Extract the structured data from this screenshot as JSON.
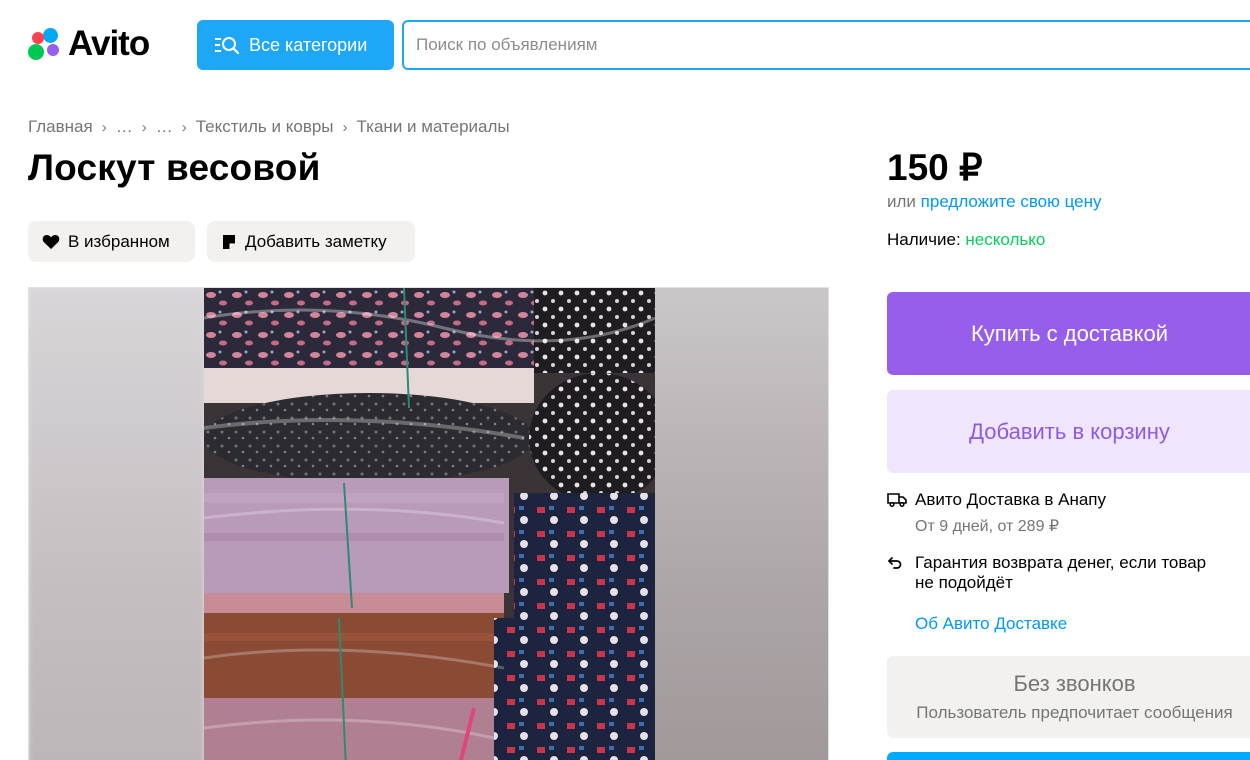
{
  "header": {
    "logo_text": "Avito",
    "categories_label": "Все категории",
    "search_placeholder": "Поиск по объявлениям"
  },
  "breadcrumb": [
    "Главная",
    "…",
    "…",
    "Текстиль и ковры",
    "Ткани и материалы"
  ],
  "listing": {
    "title": "Лоскут весовой",
    "favorite_label": "В избранном",
    "note_label": "Добавить заметку"
  },
  "sidebar": {
    "price": "150 ₽",
    "offer_prefix": "или",
    "offer_link": "предложите свою цену",
    "availability_label": "Наличие:",
    "availability_value": "несколько",
    "buy_label": "Купить с доставкой",
    "cart_label": "Добавить в корзину",
    "delivery_title": "Авито Доставка в Анапу",
    "delivery_sub": "От 9 дней, от 289 ₽",
    "guarantee_line1": "Гарантия возврата денег, если товар",
    "guarantee_line2": "не подойдёт",
    "about_delivery_link": "Об Авито Доставке",
    "no_calls_title": "Без звонков",
    "no_calls_sub": "Пользователь предпочитает сообщения"
  },
  "icons": {
    "favorite": "heart-icon",
    "note": "note-icon",
    "delivery": "truck-icon",
    "guarantee": "return-arrow-icon",
    "categories": "menu-search-icon"
  },
  "colors": {
    "accent_blue": "#1ea7f7",
    "link_blue": "#0099f7",
    "purple": "#965eeb",
    "purple_light": "#efe6fc",
    "green": "#02d15c"
  }
}
